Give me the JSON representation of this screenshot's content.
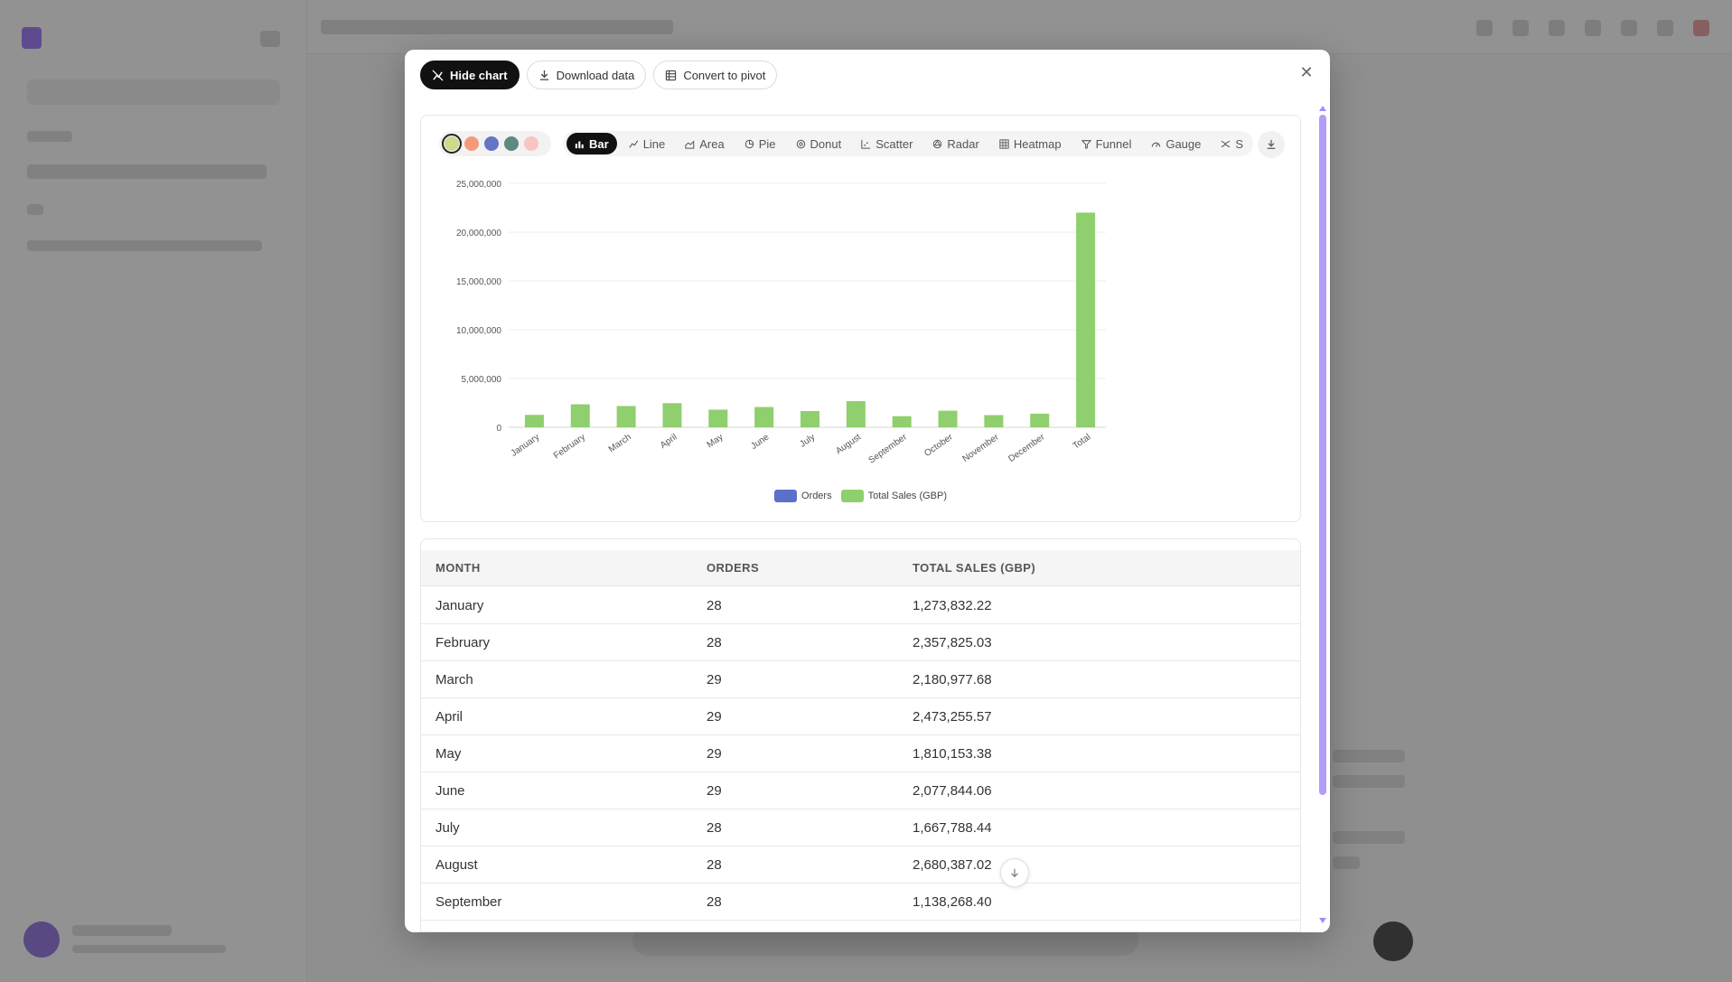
{
  "toolbar": {
    "hide_chart": "Hide chart",
    "download_data": "Download data",
    "convert_to_pivot": "Convert to pivot"
  },
  "palettes": [
    {
      "name": "pastel-mix",
      "color": "#cfd98a",
      "selected": true
    },
    {
      "name": "warm",
      "color": "#f49a7a",
      "selected": false
    },
    {
      "name": "cool",
      "color": "#6574c4",
      "selected": false
    },
    {
      "name": "teal",
      "color": "#5e8a7e",
      "selected": false
    },
    {
      "name": "soft",
      "color": "#f6c6bf",
      "selected": false
    }
  ],
  "chart_types": [
    {
      "label": "Bar",
      "icon": "bar-chart-icon",
      "active": true
    },
    {
      "label": "Line",
      "icon": "line-chart-icon",
      "active": false
    },
    {
      "label": "Area",
      "icon": "area-chart-icon",
      "active": false
    },
    {
      "label": "Pie",
      "icon": "pie-chart-icon",
      "active": false
    },
    {
      "label": "Donut",
      "icon": "donut-chart-icon",
      "active": false
    },
    {
      "label": "Scatter",
      "icon": "scatter-chart-icon",
      "active": false
    },
    {
      "label": "Radar",
      "icon": "radar-chart-icon",
      "active": false
    },
    {
      "label": "Heatmap",
      "icon": "heatmap-icon",
      "active": false
    },
    {
      "label": "Funnel",
      "icon": "funnel-icon",
      "active": false
    },
    {
      "label": "Gauge",
      "icon": "gauge-icon",
      "active": false
    },
    {
      "label": "S",
      "icon": "sankey-icon",
      "active": false
    }
  ],
  "chart_data": {
    "type": "bar",
    "categories": [
      "January",
      "February",
      "March",
      "April",
      "May",
      "June",
      "July",
      "August",
      "September",
      "October",
      "November",
      "December",
      "Total"
    ],
    "series": [
      {
        "name": "Orders",
        "color": "#5b70c9",
        "values": [
          28,
          28,
          29,
          29,
          29,
          29,
          28,
          28,
          28,
          29,
          28,
          28,
          341
        ]
      },
      {
        "name": "Total Sales (GBP)",
        "color": "#8fcf6e",
        "values": [
          1273832.22,
          2357825.03,
          2180977.68,
          2473255.57,
          1810153.38,
          2077844.06,
          1667788.44,
          2680387.02,
          1138268.4,
          1700000,
          1250000,
          1400000,
          22000000
        ]
      }
    ],
    "yticks": [
      "0",
      "5,000,000",
      "10,000,000",
      "15,000,000",
      "20,000,000",
      "25,000,000"
    ],
    "ylim": [
      0,
      25000000
    ],
    "grid": true,
    "legend_position": "bottom"
  },
  "table": {
    "headers": [
      "MONTH",
      "ORDERS",
      "TOTAL SALES (GBP)"
    ],
    "rows": [
      [
        "January",
        "28",
        "1,273,832.22"
      ],
      [
        "February",
        "28",
        "2,357,825.03"
      ],
      [
        "March",
        "29",
        "2,180,977.68"
      ],
      [
        "April",
        "29",
        "2,473,255.57"
      ],
      [
        "May",
        "29",
        "1,810,153.38"
      ],
      [
        "June",
        "29",
        "2,077,844.06"
      ],
      [
        "July",
        "28",
        "1,667,788.44"
      ],
      [
        "August",
        "28",
        "2,680,387.02"
      ],
      [
        "September",
        "28",
        "1,138,268.40"
      ]
    ]
  }
}
